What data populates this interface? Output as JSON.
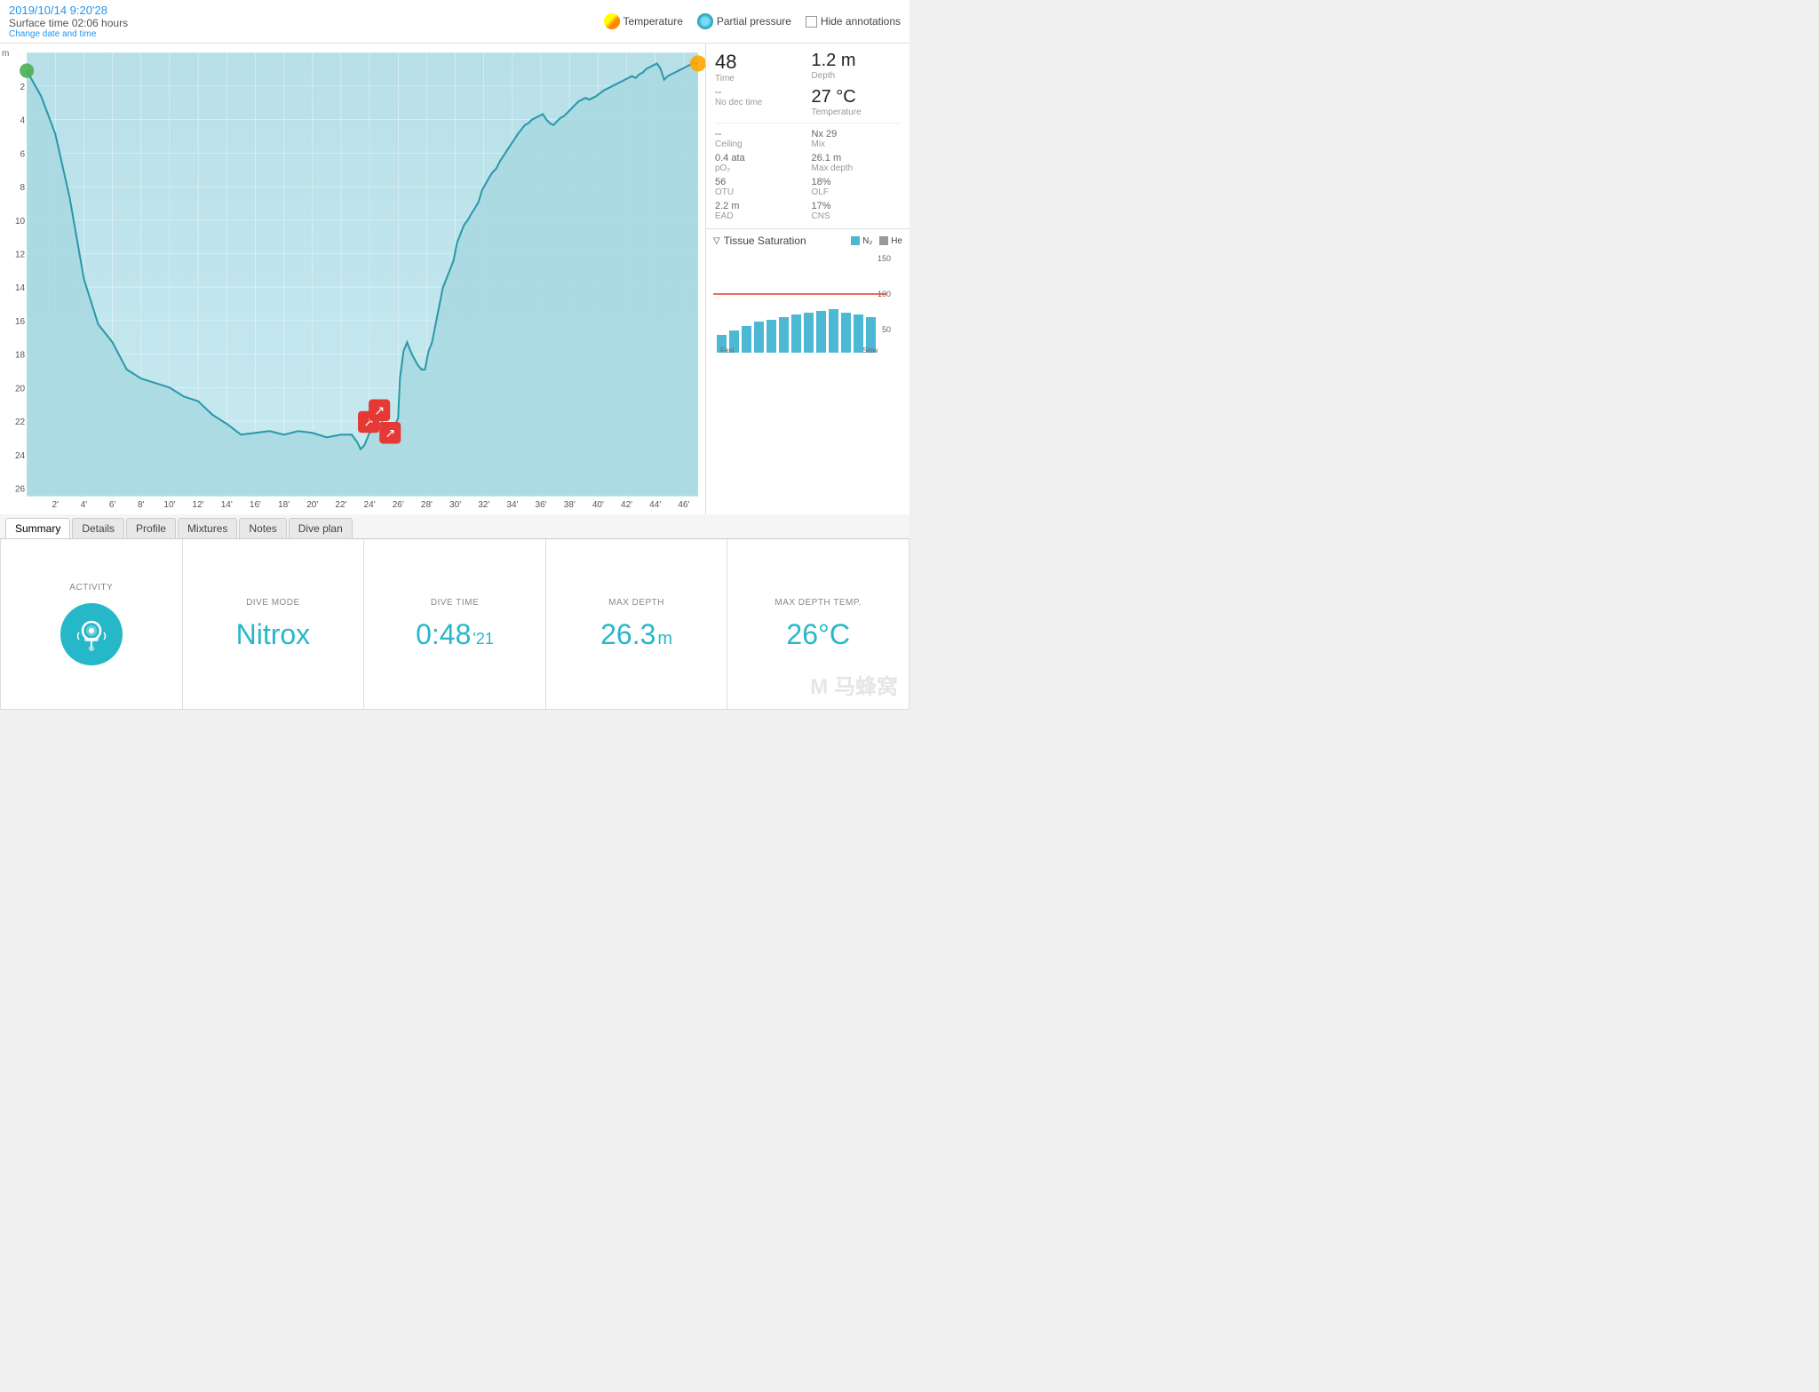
{
  "toolbar": {
    "datetime": "2019/10/14 9:20'28",
    "surface_time": "Surface time 02:06 hours",
    "change_label": "Change date and time",
    "legend_temp": "Temperature",
    "legend_pp": "Partial pressure",
    "legend_annotations": "Hide annotations"
  },
  "stats": {
    "time_value": "48",
    "time_label": "Time",
    "depth_value": "1.2 m",
    "depth_label": "Depth",
    "nodec_value": "--",
    "nodec_label": "No dec time",
    "temp_value": "27 °C",
    "temp_label": "Temperature",
    "ceiling_value": "--",
    "ceiling_label": "Ceiling",
    "mix_value": "Nx 29",
    "mix_label": "Mix",
    "po2_value": "0.4 ata",
    "po2_label": "pO₂",
    "maxdepth_value": "26.1 m",
    "maxdepth_label": "Max depth",
    "otu_value": "56",
    "otu_label": "OTU",
    "olf_value": "18%",
    "olf_label": "OLF",
    "ead_value": "2.2 m",
    "ead_label": "EAD",
    "cns_value": "17%",
    "cns_label": "CNS"
  },
  "tissue": {
    "title": "Tissue Saturation",
    "n2_label": "N₂",
    "he_label": "He"
  },
  "tabs": [
    "Summary",
    "Details",
    "Profile",
    "Mixtures",
    "Notes",
    "Dive plan"
  ],
  "active_tab": "Summary",
  "summary": {
    "activity_label": "ACTIVITY",
    "dive_mode_label": "DIVE MODE",
    "dive_mode_value": "Nitrox",
    "dive_time_label": "DIVE TIME",
    "dive_time_value": "0:48",
    "dive_time_sec": "'21",
    "max_depth_label": "MAX DEPTH",
    "max_depth_value": "26.3",
    "max_depth_unit": "m",
    "max_depth_temp_label": "MAX DEPTH TEMP.",
    "max_depth_temp_value": "26°C"
  },
  "chart": {
    "y_label": "m",
    "x_ticks": [
      "2'",
      "4'",
      "6'",
      "8'",
      "10'",
      "12'",
      "14'",
      "16'",
      "18'",
      "20'",
      "22'",
      "24'",
      "26'",
      "28'",
      "30'",
      "32'",
      "34'",
      "36'",
      "38'",
      "40'",
      "42'",
      "44'",
      "46'"
    ],
    "y_ticks": [
      "2",
      "4",
      "6",
      "8",
      "10",
      "12",
      "14",
      "16",
      "18",
      "20",
      "22",
      "24",
      "26"
    ]
  },
  "watermark": "M 马蜂窝"
}
